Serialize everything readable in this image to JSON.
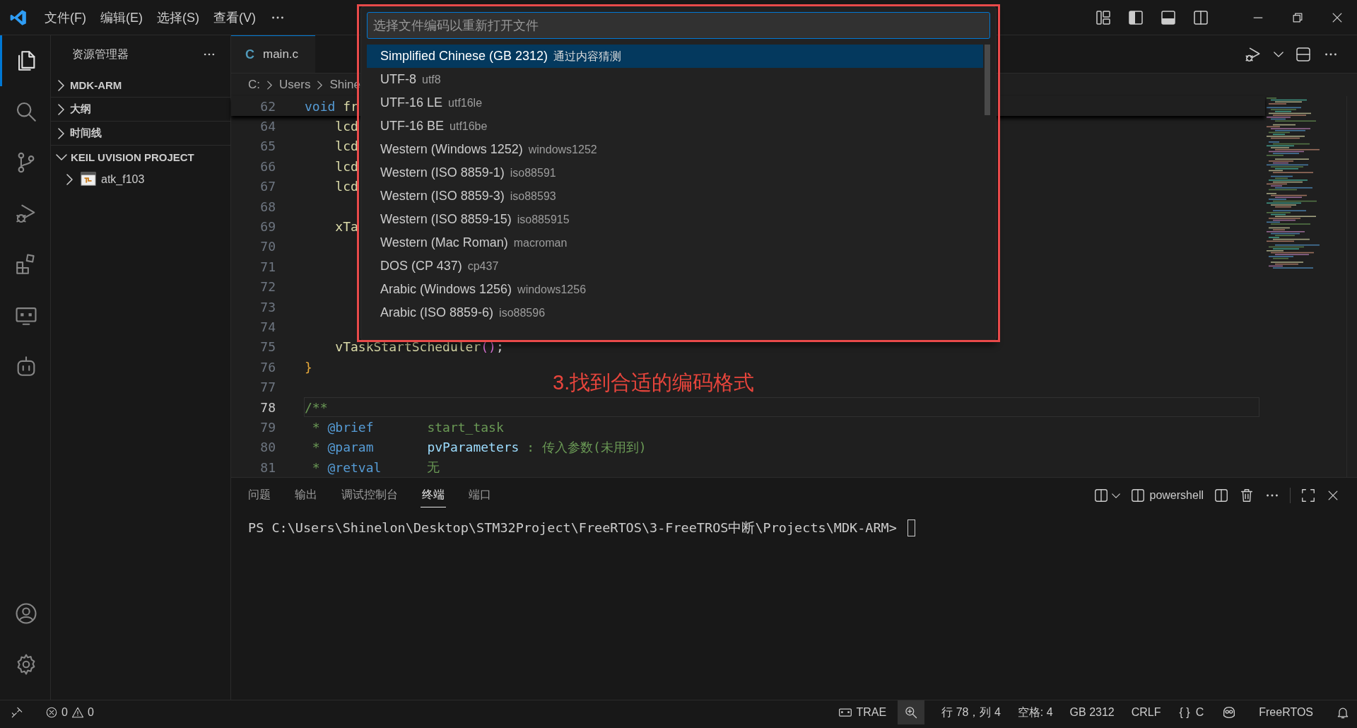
{
  "menu": [
    {
      "label": "文件(F)"
    },
    {
      "label": "编辑(E)"
    },
    {
      "label": "选择(S)"
    },
    {
      "label": "查看(V)"
    }
  ],
  "activity_bar": [
    {
      "kind": "explorer",
      "selected": true
    },
    {
      "kind": "search",
      "selected": false
    },
    {
      "kind": "source-control",
      "selected": false
    },
    {
      "kind": "run-debug",
      "selected": false
    },
    {
      "kind": "extensions",
      "selected": false
    },
    {
      "kind": "remote",
      "selected": false
    },
    {
      "kind": "robot",
      "selected": false
    },
    {
      "kind": "account",
      "selected": false
    },
    {
      "kind": "settings",
      "selected": false
    }
  ],
  "sidebar": {
    "title": "资源管理器",
    "sections": [
      {
        "label": "MDK-ARM",
        "expanded": false
      },
      {
        "label": "大纲",
        "expanded": false
      },
      {
        "label": "时间线",
        "expanded": false
      },
      {
        "label": "KEIL UVISION PROJECT",
        "expanded": true,
        "children": [
          {
            "label": "atk_f103",
            "expanded": false
          }
        ]
      }
    ]
  },
  "tabs": [
    {
      "icon": "C",
      "label": "main.c",
      "selected": true
    }
  ],
  "breadcrumb": [
    "C:",
    "Users",
    "Shine"
  ],
  "editor": {
    "sticky_line": {
      "number": "62",
      "tokens": [
        {
          "text": "void",
          "kind": "keyword"
        },
        {
          "text": " fr",
          "kind": "function"
        }
      ]
    },
    "lines": [
      {
        "number": "64",
        "current": false,
        "tokens": [
          {
            "text": "    lcd",
            "kind": "function"
          }
        ]
      },
      {
        "number": "65",
        "current": false,
        "tokens": [
          {
            "text": "    lcd",
            "kind": "function"
          }
        ]
      },
      {
        "number": "66",
        "current": false,
        "tokens": [
          {
            "text": "    lcd",
            "kind": "function"
          }
        ]
      },
      {
        "number": "67",
        "current": false,
        "tokens": [
          {
            "text": "    lcd",
            "kind": "function"
          }
        ]
      },
      {
        "number": "68",
        "current": false
      },
      {
        "number": "69",
        "current": false,
        "tokens": [
          {
            "text": "    xTa",
            "kind": "function"
          }
        ]
      },
      {
        "number": "70",
        "current": false
      },
      {
        "number": "71",
        "current": false
      },
      {
        "number": "72",
        "current": false
      },
      {
        "number": "73",
        "current": false
      },
      {
        "number": "74",
        "current": false
      },
      {
        "number": "75",
        "current": false,
        "tokens": [
          {
            "text": "    vTaskStartScheduler",
            "kind": "function"
          },
          {
            "text": "()",
            "kind": "bracket"
          },
          {
            "text": ";",
            "kind": "plain"
          }
        ]
      },
      {
        "number": "76",
        "current": false,
        "tokens": [
          {
            "text": "}",
            "kind": "brace"
          }
        ]
      },
      {
        "number": "77",
        "current": false
      },
      {
        "number": "78",
        "current": true,
        "tokens": [
          {
            "text": "/**",
            "kind": "comment"
          }
        ]
      },
      {
        "number": "79",
        "current": false,
        "tokens": [
          {
            "text": " * ",
            "kind": "comment"
          },
          {
            "text": "@brief",
            "kind": "tag"
          },
          {
            "text": "       start_task",
            "kind": "comment"
          }
        ]
      },
      {
        "number": "80",
        "current": false,
        "tokens": [
          {
            "text": " * ",
            "kind": "comment"
          },
          {
            "text": "@param",
            "kind": "tag"
          },
          {
            "text": "       pvParameters",
            "kind": "param"
          },
          {
            "text": " : 传入参数(未用到)",
            "kind": "comment"
          }
        ]
      },
      {
        "number": "81",
        "current": false,
        "tokens": [
          {
            "text": " * ",
            "kind": "comment"
          },
          {
            "text": "@retval",
            "kind": "tag"
          },
          {
            "text": "      无",
            "kind": "comment"
          }
        ]
      }
    ]
  },
  "quick_pick": {
    "placeholder": "选择文件编码以重新打开文件",
    "items": [
      {
        "label": "Simplified Chinese (GB 2312)",
        "detail": "通过内容猜测",
        "selected": true
      },
      {
        "label": "UTF-8",
        "detail": "utf8",
        "selected": false
      },
      {
        "label": "UTF-16 LE",
        "detail": "utf16le",
        "selected": false
      },
      {
        "label": "UTF-16 BE",
        "detail": "utf16be",
        "selected": false
      },
      {
        "label": "Western (Windows 1252)",
        "detail": "windows1252",
        "selected": false
      },
      {
        "label": "Western (ISO 8859-1)",
        "detail": "iso88591",
        "selected": false
      },
      {
        "label": "Western (ISO 8859-3)",
        "detail": "iso88593",
        "selected": false
      },
      {
        "label": "Western (ISO 8859-15)",
        "detail": "iso885915",
        "selected": false
      },
      {
        "label": "Western (Mac Roman)",
        "detail": "macroman",
        "selected": false
      },
      {
        "label": "DOS (CP 437)",
        "detail": "cp437",
        "selected": false
      },
      {
        "label": "Arabic (Windows 1256)",
        "detail": "windows1256",
        "selected": false
      },
      {
        "label": "Arabic (ISO 8859-6)",
        "detail": "iso88596",
        "selected": false
      }
    ]
  },
  "annotation": {
    "text": "3.找到合适的编码格式"
  },
  "panel": {
    "tabs": [
      {
        "label": "问题",
        "selected": false
      },
      {
        "label": "输出",
        "selected": false
      },
      {
        "label": "调试控制台",
        "selected": false
      },
      {
        "label": "终端",
        "selected": true
      },
      {
        "label": "端口",
        "selected": false
      }
    ],
    "terminal_name": "powershell",
    "prompt": "PS C:\\Users\\Shinelon\\Desktop\\STM32Project\\FreeRTOS\\3-FreeTROS中断\\Projects\\MDK-ARM> "
  },
  "status_bar": {
    "errors": "0",
    "warnings": "0",
    "trae": "TRAE",
    "position": "行 78，列 4",
    "indent": "空格: 4",
    "encoding": "GB 2312",
    "eol": "CRLF",
    "language_icon": "{ }",
    "language": "C",
    "extension": "FreeRTOS"
  }
}
